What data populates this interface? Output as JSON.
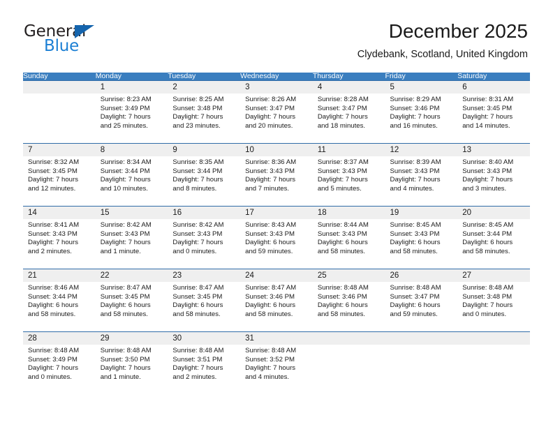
{
  "brand": {
    "name_part1": "General",
    "name_part2": "Blue",
    "triangle_icon": "blue-triangle-icon",
    "colors": {
      "dark": "#231f20",
      "blue": "#1b7fd4",
      "triangle": "#1464ad"
    }
  },
  "header": {
    "title": "December 2025",
    "subtitle": "Clydebank, Scotland, United Kingdom"
  },
  "theme": {
    "header_row_bg": "#3a7ebf",
    "header_row_text": "#ffffff",
    "day_band_bg": "#efefef",
    "row_divider": "#2f6ca8",
    "text": "#1a1a1a"
  },
  "weekdays": [
    "Sunday",
    "Monday",
    "Tuesday",
    "Wednesday",
    "Thursday",
    "Friday",
    "Saturday"
  ],
  "weeks": [
    [
      {
        "day": "",
        "empty": true,
        "sunrise": "",
        "sunset": "",
        "daylight1": "",
        "daylight2": ""
      },
      {
        "day": "1",
        "empty": false,
        "sunrise": "Sunrise: 8:23 AM",
        "sunset": "Sunset: 3:49 PM",
        "daylight1": "Daylight: 7 hours",
        "daylight2": "and 25 minutes."
      },
      {
        "day": "2",
        "empty": false,
        "sunrise": "Sunrise: 8:25 AM",
        "sunset": "Sunset: 3:48 PM",
        "daylight1": "Daylight: 7 hours",
        "daylight2": "and 23 minutes."
      },
      {
        "day": "3",
        "empty": false,
        "sunrise": "Sunrise: 8:26 AM",
        "sunset": "Sunset: 3:47 PM",
        "daylight1": "Daylight: 7 hours",
        "daylight2": "and 20 minutes."
      },
      {
        "day": "4",
        "empty": false,
        "sunrise": "Sunrise: 8:28 AM",
        "sunset": "Sunset: 3:47 PM",
        "daylight1": "Daylight: 7 hours",
        "daylight2": "and 18 minutes."
      },
      {
        "day": "5",
        "empty": false,
        "sunrise": "Sunrise: 8:29 AM",
        "sunset": "Sunset: 3:46 PM",
        "daylight1": "Daylight: 7 hours",
        "daylight2": "and 16 minutes."
      },
      {
        "day": "6",
        "empty": false,
        "sunrise": "Sunrise: 8:31 AM",
        "sunset": "Sunset: 3:45 PM",
        "daylight1": "Daylight: 7 hours",
        "daylight2": "and 14 minutes."
      }
    ],
    [
      {
        "day": "7",
        "empty": false,
        "sunrise": "Sunrise: 8:32 AM",
        "sunset": "Sunset: 3:45 PM",
        "daylight1": "Daylight: 7 hours",
        "daylight2": "and 12 minutes."
      },
      {
        "day": "8",
        "empty": false,
        "sunrise": "Sunrise: 8:34 AM",
        "sunset": "Sunset: 3:44 PM",
        "daylight1": "Daylight: 7 hours",
        "daylight2": "and 10 minutes."
      },
      {
        "day": "9",
        "empty": false,
        "sunrise": "Sunrise: 8:35 AM",
        "sunset": "Sunset: 3:44 PM",
        "daylight1": "Daylight: 7 hours",
        "daylight2": "and 8 minutes."
      },
      {
        "day": "10",
        "empty": false,
        "sunrise": "Sunrise: 8:36 AM",
        "sunset": "Sunset: 3:43 PM",
        "daylight1": "Daylight: 7 hours",
        "daylight2": "and 7 minutes."
      },
      {
        "day": "11",
        "empty": false,
        "sunrise": "Sunrise: 8:37 AM",
        "sunset": "Sunset: 3:43 PM",
        "daylight1": "Daylight: 7 hours",
        "daylight2": "and 5 minutes."
      },
      {
        "day": "12",
        "empty": false,
        "sunrise": "Sunrise: 8:39 AM",
        "sunset": "Sunset: 3:43 PM",
        "daylight1": "Daylight: 7 hours",
        "daylight2": "and 4 minutes."
      },
      {
        "day": "13",
        "empty": false,
        "sunrise": "Sunrise: 8:40 AM",
        "sunset": "Sunset: 3:43 PM",
        "daylight1": "Daylight: 7 hours",
        "daylight2": "and 3 minutes."
      }
    ],
    [
      {
        "day": "14",
        "empty": false,
        "sunrise": "Sunrise: 8:41 AM",
        "sunset": "Sunset: 3:43 PM",
        "daylight1": "Daylight: 7 hours",
        "daylight2": "and 2 minutes."
      },
      {
        "day": "15",
        "empty": false,
        "sunrise": "Sunrise: 8:42 AM",
        "sunset": "Sunset: 3:43 PM",
        "daylight1": "Daylight: 7 hours",
        "daylight2": "and 1 minute."
      },
      {
        "day": "16",
        "empty": false,
        "sunrise": "Sunrise: 8:42 AM",
        "sunset": "Sunset: 3:43 PM",
        "daylight1": "Daylight: 7 hours",
        "daylight2": "and 0 minutes."
      },
      {
        "day": "17",
        "empty": false,
        "sunrise": "Sunrise: 8:43 AM",
        "sunset": "Sunset: 3:43 PM",
        "daylight1": "Daylight: 6 hours",
        "daylight2": "and 59 minutes."
      },
      {
        "day": "18",
        "empty": false,
        "sunrise": "Sunrise: 8:44 AM",
        "sunset": "Sunset: 3:43 PM",
        "daylight1": "Daylight: 6 hours",
        "daylight2": "and 58 minutes."
      },
      {
        "day": "19",
        "empty": false,
        "sunrise": "Sunrise: 8:45 AM",
        "sunset": "Sunset: 3:43 PM",
        "daylight1": "Daylight: 6 hours",
        "daylight2": "and 58 minutes."
      },
      {
        "day": "20",
        "empty": false,
        "sunrise": "Sunrise: 8:45 AM",
        "sunset": "Sunset: 3:44 PM",
        "daylight1": "Daylight: 6 hours",
        "daylight2": "and 58 minutes."
      }
    ],
    [
      {
        "day": "21",
        "empty": false,
        "sunrise": "Sunrise: 8:46 AM",
        "sunset": "Sunset: 3:44 PM",
        "daylight1": "Daylight: 6 hours",
        "daylight2": "and 58 minutes."
      },
      {
        "day": "22",
        "empty": false,
        "sunrise": "Sunrise: 8:47 AM",
        "sunset": "Sunset: 3:45 PM",
        "daylight1": "Daylight: 6 hours",
        "daylight2": "and 58 minutes."
      },
      {
        "day": "23",
        "empty": false,
        "sunrise": "Sunrise: 8:47 AM",
        "sunset": "Sunset: 3:45 PM",
        "daylight1": "Daylight: 6 hours",
        "daylight2": "and 58 minutes."
      },
      {
        "day": "24",
        "empty": false,
        "sunrise": "Sunrise: 8:47 AM",
        "sunset": "Sunset: 3:46 PM",
        "daylight1": "Daylight: 6 hours",
        "daylight2": "and 58 minutes."
      },
      {
        "day": "25",
        "empty": false,
        "sunrise": "Sunrise: 8:48 AM",
        "sunset": "Sunset: 3:46 PM",
        "daylight1": "Daylight: 6 hours",
        "daylight2": "and 58 minutes."
      },
      {
        "day": "26",
        "empty": false,
        "sunrise": "Sunrise: 8:48 AM",
        "sunset": "Sunset: 3:47 PM",
        "daylight1": "Daylight: 6 hours",
        "daylight2": "and 59 minutes."
      },
      {
        "day": "27",
        "empty": false,
        "sunrise": "Sunrise: 8:48 AM",
        "sunset": "Sunset: 3:48 PM",
        "daylight1": "Daylight: 7 hours",
        "daylight2": "and 0 minutes."
      }
    ],
    [
      {
        "day": "28",
        "empty": false,
        "sunrise": "Sunrise: 8:48 AM",
        "sunset": "Sunset: 3:49 PM",
        "daylight1": "Daylight: 7 hours",
        "daylight2": "and 0 minutes."
      },
      {
        "day": "29",
        "empty": false,
        "sunrise": "Sunrise: 8:48 AM",
        "sunset": "Sunset: 3:50 PM",
        "daylight1": "Daylight: 7 hours",
        "daylight2": "and 1 minute."
      },
      {
        "day": "30",
        "empty": false,
        "sunrise": "Sunrise: 8:48 AM",
        "sunset": "Sunset: 3:51 PM",
        "daylight1": "Daylight: 7 hours",
        "daylight2": "and 2 minutes."
      },
      {
        "day": "31",
        "empty": false,
        "sunrise": "Sunrise: 8:48 AM",
        "sunset": "Sunset: 3:52 PM",
        "daylight1": "Daylight: 7 hours",
        "daylight2": "and 4 minutes."
      },
      {
        "day": "",
        "empty": true,
        "sunrise": "",
        "sunset": "",
        "daylight1": "",
        "daylight2": ""
      },
      {
        "day": "",
        "empty": true,
        "sunrise": "",
        "sunset": "",
        "daylight1": "",
        "daylight2": ""
      },
      {
        "day": "",
        "empty": true,
        "sunrise": "",
        "sunset": "",
        "daylight1": "",
        "daylight2": ""
      }
    ]
  ]
}
